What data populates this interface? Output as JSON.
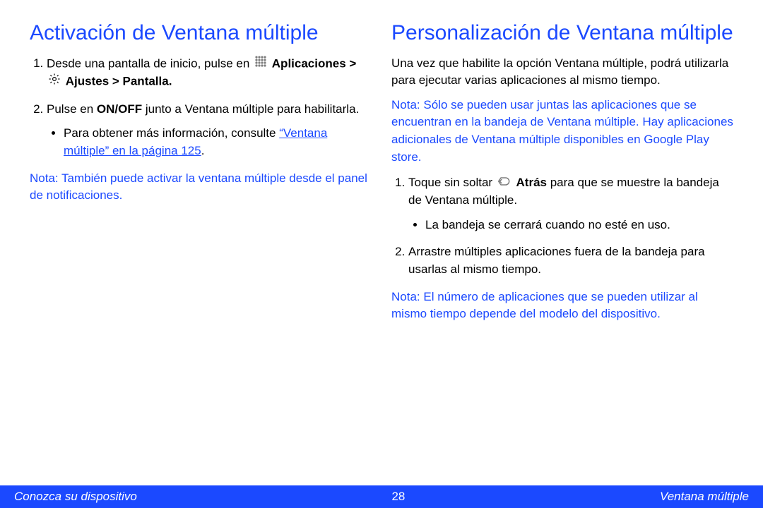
{
  "left": {
    "heading": "Activación de Ventana múltiple",
    "step1_a": "Desde una pantalla de inicio, pulse en ",
    "step1_b": "Aplicaciones > ",
    "step1_c": " Ajustes > Pantalla.",
    "step2_a": "Pulse en ",
    "step2_b": "ON/OFF",
    "step2_c": " junto a Ventana múltiple para habilitarla.",
    "sub1_a": "Para obtener más información, consulte ",
    "sub1_link": "“Ventana múltiple” en la página 125",
    "sub1_dot": ".",
    "note_label": "Nota",
    "note_text": ": También puede activar la ventana múltiple desde el panel de notificaciones."
  },
  "right": {
    "heading": "Personalización de Ventana múltiple",
    "intro": "Una vez que habilite la opción Ventana múltiple, podrá utilizarla para ejecutar varias aplicaciones al mismo tiempo.",
    "note1_label": "Nota",
    "note1_text": ": Sólo se pueden usar juntas las aplicaciones que se encuentran en la bandeja de Ventana múltiple. Hay aplicaciones adicionales de Ventana múltiple disponibles en Google Play store.",
    "step1_a": "Toque sin soltar ",
    "step1_b": " Atrás",
    "step1_c": " para que se muestre la bandeja de Ventana múltiple.",
    "sub1": "La bandeja se cerrará cuando no esté en uso.",
    "step2": "Arrastre múltiples aplicaciones fuera de la bandeja para usarlas al mismo tiempo.",
    "note2_label": "Nota",
    "note2_text": ": El número de aplicaciones que se pueden utilizar al mismo tiempo depende del modelo del dispositivo."
  },
  "footer": {
    "left": "Conozca su dispositivo",
    "page": "28",
    "right": "Ventana múltiple"
  }
}
